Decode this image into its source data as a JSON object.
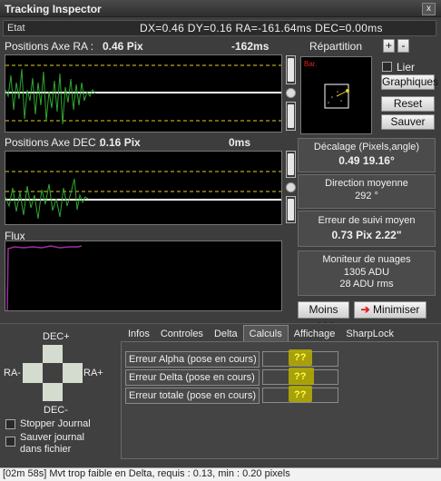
{
  "window": {
    "title": "Tracking Inspector",
    "close_label": "x"
  },
  "status": {
    "label": "Etat",
    "value": "DX=0.46  DY=0.16 RA=-161.64ms   DEC=0.00ms"
  },
  "ra": {
    "label": "Positions Axe RA :",
    "pix": "0.46 Pix",
    "ms": "-162ms"
  },
  "dec": {
    "label": "Positions Axe DEC :",
    "pix": "0.16 Pix",
    "ms": "0ms"
  },
  "flux": {
    "label": "Flux"
  },
  "repartition": {
    "label": "Répartition",
    "plus_label": "+",
    "minus_label": "-",
    "plot_label": "Bar."
  },
  "options": {
    "lier_label": "Lier",
    "graphiques_label": "Graphiques",
    "reset_label": "Reset",
    "sauver_label": "Sauver"
  },
  "decalage": {
    "title": "Décalage (Pixels,angle)",
    "value": "0.49  19.16°"
  },
  "direction": {
    "title": "Direction moyenne",
    "value": "292 °"
  },
  "erreur": {
    "title": "Erreur de suivi moyen",
    "value": "0.73 Pix  2.22\""
  },
  "nuages": {
    "title": "Moniteur de nuages",
    "adu": "1305 ADU",
    "rms": "28 ADU rms"
  },
  "buttons": {
    "moins_label": "Moins <<<",
    "minimiser_label": "Minimiser"
  },
  "tabs": [
    "Infos",
    "Controles",
    "Delta",
    "Calculs",
    "Affichage",
    "SharpLock"
  ],
  "active_tab": "Calculs",
  "calculs": [
    {
      "label": "Erreur Alpha (pose en cours)",
      "value": "??"
    },
    {
      "label": "Erreur Delta (pose en cours)",
      "value": "??"
    },
    {
      "label": "Erreur totale (pose en cours)",
      "value": "??"
    }
  ],
  "pad": {
    "up": "DEC+",
    "down": "DEC-",
    "left": "RA-",
    "right": "RA+"
  },
  "checks": {
    "stopper_label": "Stopper Journal",
    "sauver_line1": "Sauver journal",
    "sauver_line2": "dans fichier"
  },
  "log": {
    "text": "[02m 58s] Mvt trop faible en Delta, requis : 0.13, min : 0.20 pixels"
  },
  "colors": {
    "trace": "#2fa82f",
    "threshold": "#e0d020",
    "flux": "#9a2fa0",
    "highlight": "#b8b000",
    "minimiser_arrow": "#e02020"
  }
}
